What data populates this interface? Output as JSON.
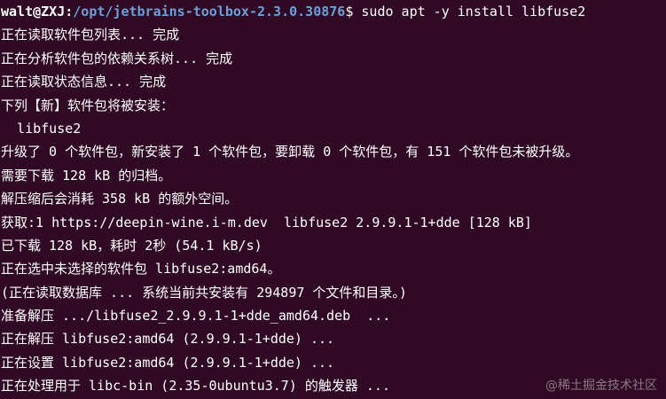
{
  "terminal": {
    "prompt": {
      "user_host": "walt@ZXJ",
      "separator": ":",
      "path": "/opt/jetbrains-toolbox-2.3.0.30876",
      "symbol": "$",
      "command": " sudo apt -y install libfuse2"
    },
    "lines": [
      "正在读取软件包列表... 完成",
      "正在分析软件包的依赖关系树... 完成",
      "正在读取状态信息... 完成",
      "下列【新】软件包将被安装：",
      "  libfuse2",
      "升级了 0 个软件包，新安装了 1 个软件包，要卸载 0 个软件包，有 151 个软件包未被升级。",
      "需要下载 128 kB 的归档。",
      "解压缩后会消耗 358 kB 的额外空间。",
      "获取:1 https://deepin-wine.i-m.dev  libfuse2 2.9.9.1-1+dde [128 kB]",
      "已下载 128 kB，耗时 2秒 (54.1 kB/s)",
      "正在选中未选择的软件包 libfuse2:amd64。",
      "(正在读取数据库 ... 系统当前共安装有 294897 个文件和目录。)",
      "准备解压 .../libfuse2_2.9.9.1-1+dde_amd64.deb  ...",
      "正在解压 libfuse2:amd64 (2.9.9.1-1+dde) ...",
      "正在设置 libfuse2:amd64 (2.9.9.1-1+dde) ...",
      "正在处理用于 libc-bin (2.35-0ubuntu3.7) 的触发器 ..."
    ]
  },
  "watermark": "@稀土掘金技术社区",
  "colors": {
    "background": "#300a24",
    "text": "#ffffff",
    "path": "#6f9fd8"
  }
}
